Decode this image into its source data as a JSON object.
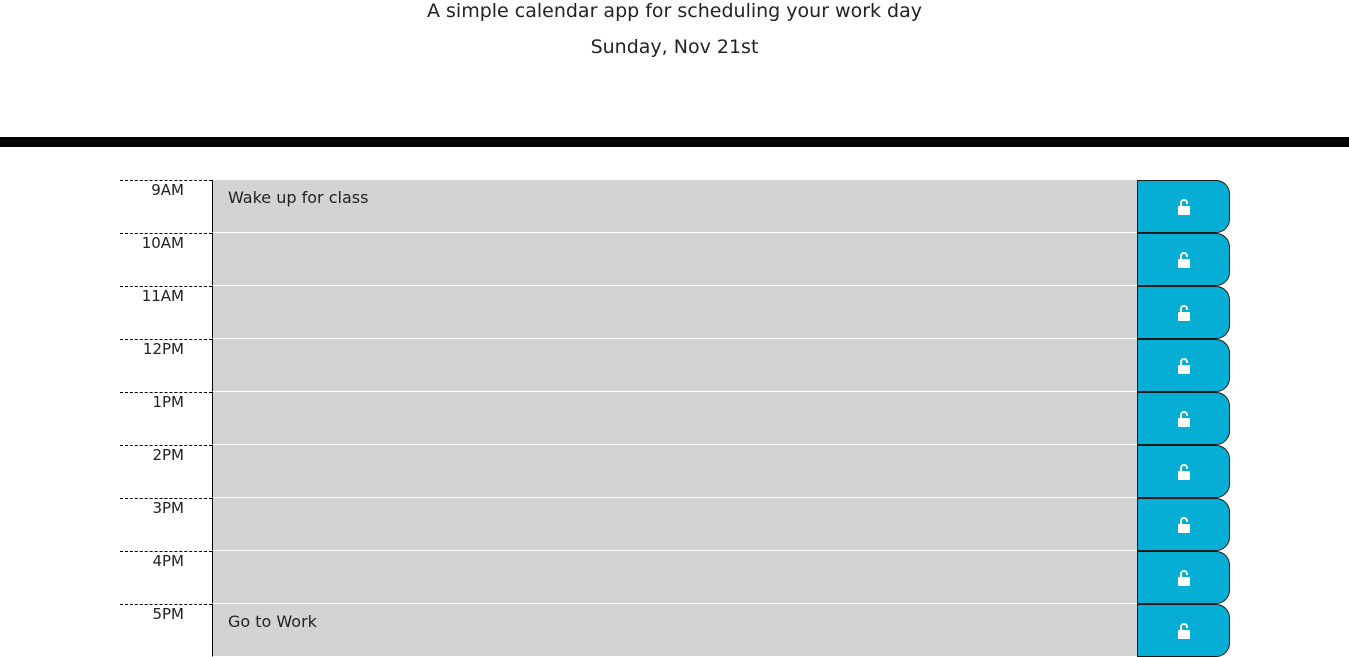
{
  "header": {
    "lead": "A simple calendar app for scheduling your work day",
    "current_day": "Sunday, Nov 21st"
  },
  "colors": {
    "accent": "#06aed5",
    "row_background": "#d3d3d3",
    "divider": "#000000"
  },
  "rows": [
    {
      "hour": "9AM",
      "text": "Wake up for class",
      "icon": "unlock-icon"
    },
    {
      "hour": "10AM",
      "text": "",
      "icon": "unlock-icon"
    },
    {
      "hour": "11AM",
      "text": "",
      "icon": "unlock-icon"
    },
    {
      "hour": "12PM",
      "text": "",
      "icon": "unlock-icon"
    },
    {
      "hour": "1PM",
      "text": "",
      "icon": "unlock-icon"
    },
    {
      "hour": "2PM",
      "text": "",
      "icon": "unlock-icon"
    },
    {
      "hour": "3PM",
      "text": "",
      "icon": "unlock-icon"
    },
    {
      "hour": "4PM",
      "text": "",
      "icon": "unlock-icon"
    },
    {
      "hour": "5PM",
      "text": "Go to Work",
      "icon": "unlock-icon"
    }
  ]
}
